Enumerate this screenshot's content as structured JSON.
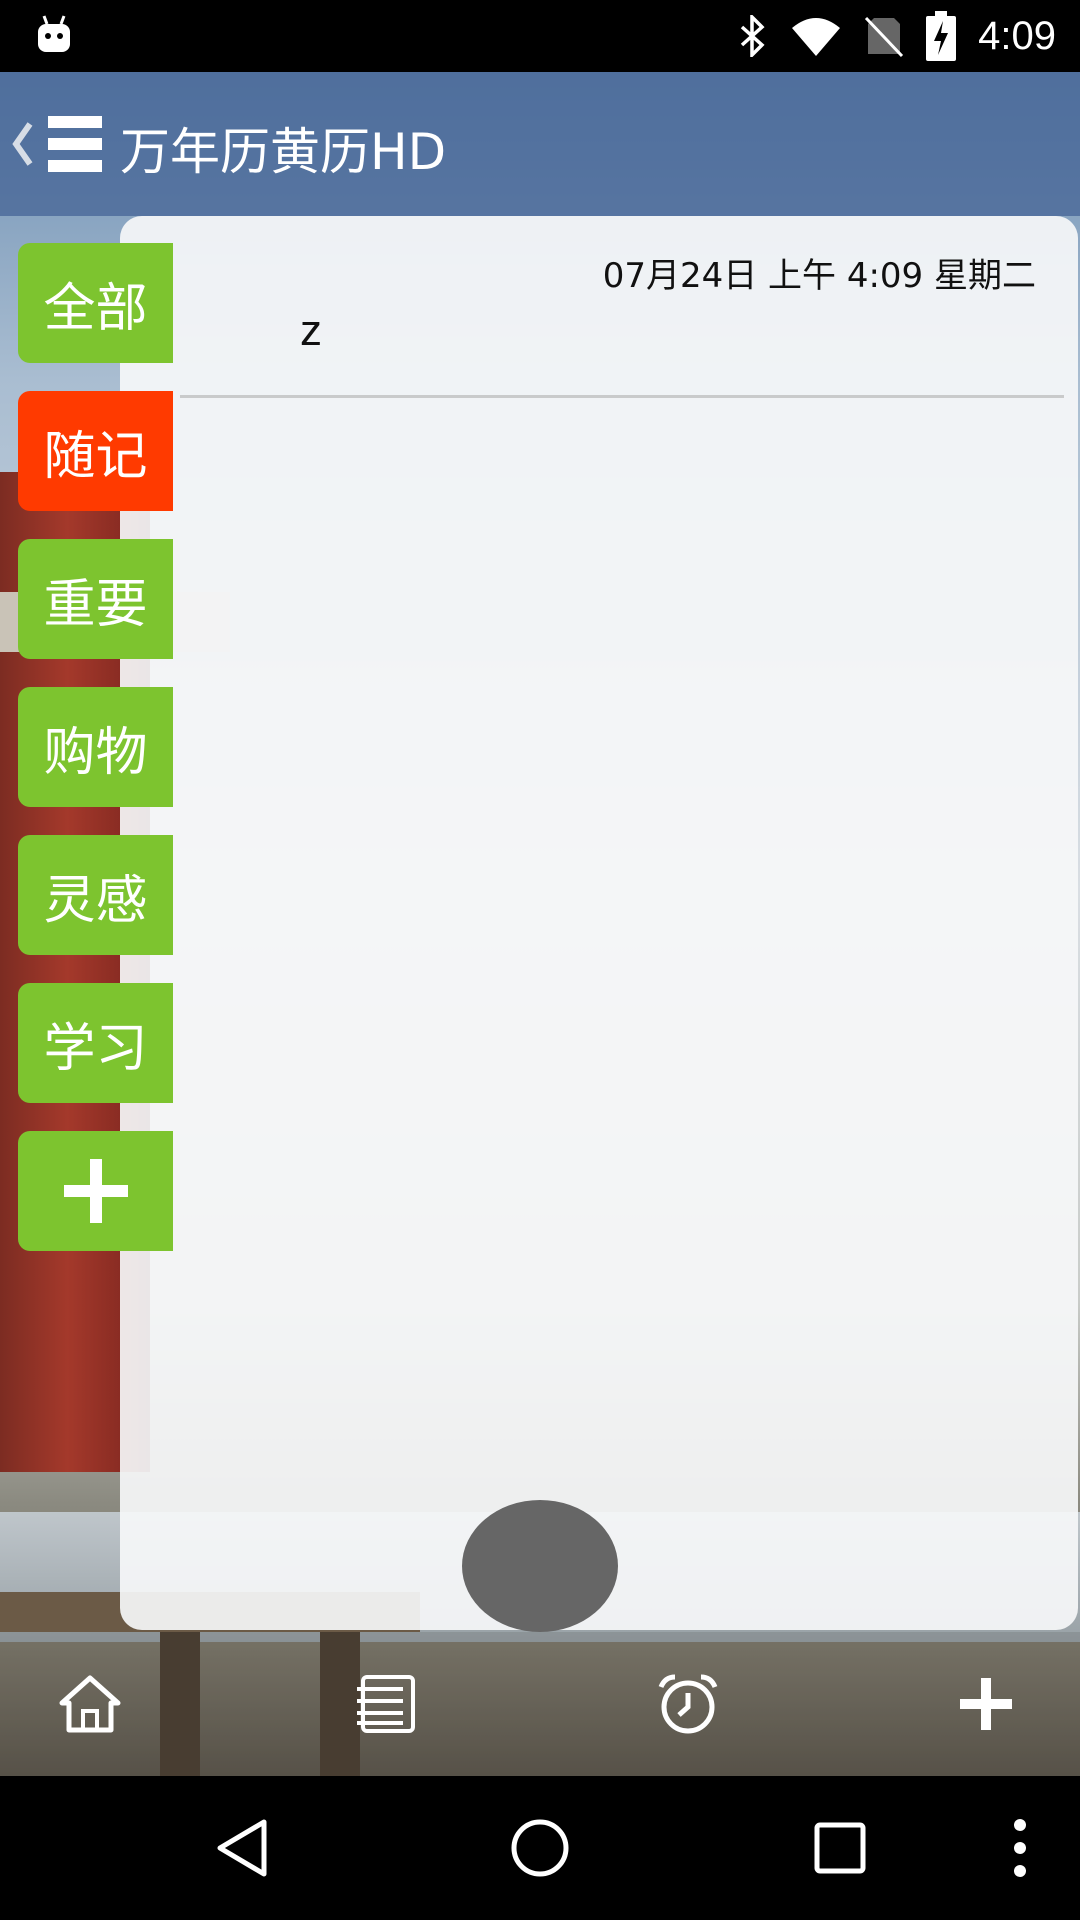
{
  "status_bar": {
    "time": "4:09",
    "icons": [
      "android-debug-icon",
      "bluetooth-icon",
      "wifi-icon",
      "no-sim-icon",
      "battery-charging-icon"
    ]
  },
  "header": {
    "title": "万年历黄历HD",
    "icons": [
      "back-chevron-icon",
      "menu-icon"
    ]
  },
  "categories": [
    {
      "label": "全部",
      "active": false
    },
    {
      "label": "随记",
      "active": true
    },
    {
      "label": "重要",
      "active": false
    },
    {
      "label": "购物",
      "active": false
    },
    {
      "label": "灵感",
      "active": false
    },
    {
      "label": "学习",
      "active": false
    },
    {
      "label": "",
      "icon": "plus-icon",
      "active": false
    }
  ],
  "notes": [
    {
      "date": "07月24日 上午 4:09 星期二",
      "text": "z"
    }
  ],
  "bottom_toolbar": {
    "icons": [
      "home-icon",
      "list-icon",
      "alarm-clock-icon",
      "plus-icon"
    ]
  },
  "nav_bar": {
    "icons": [
      "back-icon",
      "home-circle-icon",
      "recents-icon",
      "more-vert-icon"
    ]
  },
  "colors": {
    "tab_green": "#7dc42f",
    "tab_active": "#ff3a00",
    "fab_gray": "#666666"
  }
}
